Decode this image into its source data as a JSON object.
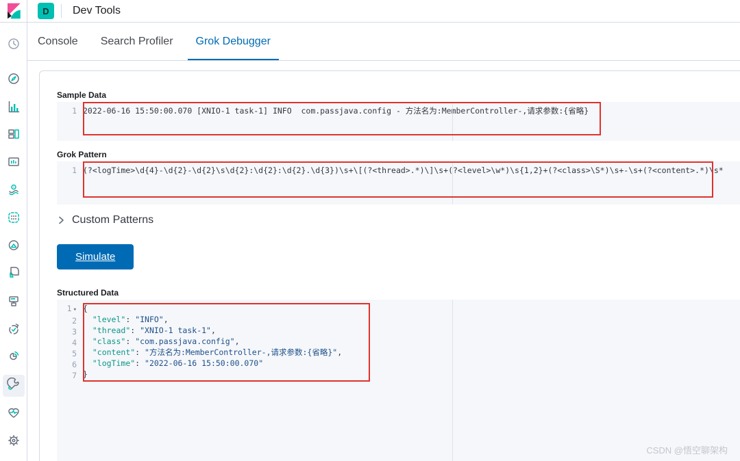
{
  "topbar": {
    "app_badge": "D",
    "title": "Dev Tools"
  },
  "tabs": [
    {
      "label": "Console",
      "active": false
    },
    {
      "label": "Search Profiler",
      "active": false
    },
    {
      "label": "Grok Debugger",
      "active": true
    }
  ],
  "sidebar": {
    "icons": [
      "recently-viewed-icon",
      "discover-icon",
      "visualize-icon",
      "dashboard-icon",
      "canvas-icon",
      "maps-icon",
      "machine-learning-icon",
      "graph-icon",
      "metrics-icon",
      "logs-icon",
      "uptime-icon",
      "apm-icon",
      "dev-tools-icon",
      "monitoring-icon",
      "management-icon"
    ],
    "active_icon": "dev-tools-icon"
  },
  "sections": {
    "sample_data": {
      "label": "Sample Data",
      "line_number": "1",
      "content": "2022-06-16 15:50:00.070 [XNIO-1 task-1] INFO  com.passjava.config - 方法名为:MemberController-,请求参数:{省略}"
    },
    "grok_pattern": {
      "label": "Grok Pattern",
      "line_number": "1",
      "content": "(?<logTime>\\d{4}-\\d{2}-\\d{2}\\s\\d{2}:\\d{2}:\\d{2}.\\d{3})\\s+\\[(?<thread>.*)\\]\\s+(?<level>\\w*)\\s{1,2}+(?<class>\\S*)\\s+-\\s+(?<content>.*)\\s*"
    },
    "custom_patterns": {
      "label": "Custom Patterns"
    },
    "simulate_button": {
      "label": "Simulate"
    },
    "structured_data": {
      "label": "Structured Data",
      "json_lines": [
        {
          "num": "1",
          "fold": true,
          "tokens": [
            {
              "t": "{"
            }
          ]
        },
        {
          "num": "2",
          "tokens": [
            {
              "t": "  "
            },
            {
              "t": "\"level\"",
              "c": "key"
            },
            {
              "t": ": "
            },
            {
              "t": "\"INFO\"",
              "c": "val"
            },
            {
              "t": ","
            }
          ]
        },
        {
          "num": "3",
          "tokens": [
            {
              "t": "  "
            },
            {
              "t": "\"thread\"",
              "c": "key"
            },
            {
              "t": ": "
            },
            {
              "t": "\"XNIO-1 task-1\"",
              "c": "val"
            },
            {
              "t": ","
            }
          ]
        },
        {
          "num": "4",
          "tokens": [
            {
              "t": "  "
            },
            {
              "t": "\"class\"",
              "c": "key"
            },
            {
              "t": ": "
            },
            {
              "t": "\"com.passjava.config\"",
              "c": "val"
            },
            {
              "t": ","
            }
          ]
        },
        {
          "num": "5",
          "tokens": [
            {
              "t": "  "
            },
            {
              "t": "\"content\"",
              "c": "key"
            },
            {
              "t": ": "
            },
            {
              "t": "\"方法名为:MemberController-,请求参数:{省略}\"",
              "c": "val"
            },
            {
              "t": ","
            }
          ]
        },
        {
          "num": "6",
          "tokens": [
            {
              "t": "  "
            },
            {
              "t": "\"logTime\"",
              "c": "key"
            },
            {
              "t": ": "
            },
            {
              "t": "\"2022-06-16 15:50:00.070\"",
              "c": "val"
            }
          ]
        },
        {
          "num": "7",
          "tokens": [
            {
              "t": "}"
            }
          ]
        }
      ]
    }
  },
  "colors": {
    "accent_teal": "#00BFB3",
    "primary_blue": "#006BB4",
    "annotation_red": "#E0312D",
    "logo_pink": "#F04E98",
    "json_key": "#0e9488",
    "json_value": "#1e4f8a",
    "border": "#D3DAE6"
  },
  "watermark": "CSDN @悟空聊架构"
}
